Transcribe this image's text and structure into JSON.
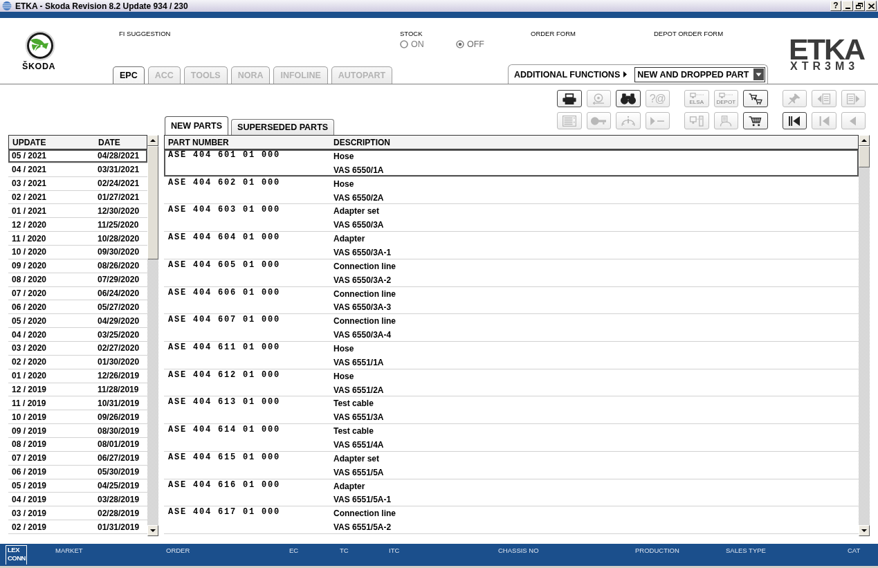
{
  "window": {
    "title": "ETKA - Skoda Revision 8.2 Update 934 / 230",
    "help_button": "?"
  },
  "header": {
    "brand": "ŠKODA",
    "fi_suggestion": "FI SUGGESTION",
    "stock": {
      "label": "STOCK",
      "options": [
        {
          "label": "ON",
          "selected": false
        },
        {
          "label": "OFF",
          "selected": true
        }
      ]
    },
    "order_form": "ORDER FORM",
    "depot_order_form": "DEPOT ORDER FORM",
    "logo": {
      "title": "ETKA",
      "subtitle": "XTR3M3"
    },
    "module_tabs": [
      {
        "label": "EPC",
        "selected": true,
        "disabled": false
      },
      {
        "label": "ACC",
        "selected": false,
        "disabled": true
      },
      {
        "label": "TOOLS",
        "selected": false,
        "disabled": true
      },
      {
        "label": "NORA",
        "selected": false,
        "disabled": true
      },
      {
        "label": "INFOLINE",
        "selected": false,
        "disabled": true
      },
      {
        "label": "AUTOPART",
        "selected": false,
        "disabled": true
      }
    ],
    "additional_functions": {
      "label": "ADDITIONAL FUNCTIONS",
      "value": "NEW AND DROPPED PART"
    }
  },
  "toolbar": {
    "rows": [
      {
        "groups": [
          {
            "buttons": [
              {
                "kind": "printer",
                "disabled": false
              },
              {
                "kind": "disc",
                "disabled": true
              },
              {
                "kind": "binoculars",
                "disabled": false
              },
              {
                "kind": "glyph",
                "label": "?@",
                "disabled": true
              }
            ]
          },
          {
            "buttons": [
              {
                "kind": "monitor",
                "label": "ELSA",
                "disabled": true
              },
              {
                "kind": "monitor",
                "label": "DEPOT",
                "disabled": true
              },
              {
                "kind": "carts",
                "disabled": false
              }
            ]
          },
          {
            "buttons": [
              {
                "kind": "pin",
                "disabled": true
              },
              {
                "kind": "pageback",
                "disabled": true
              },
              {
                "kind": "pagefwd",
                "disabled": true
              }
            ]
          }
        ]
      },
      {
        "groups": [
          {
            "buttons": [
              {
                "kind": "list",
                "disabled": true
              },
              {
                "kind": "key",
                "disabled": true
              },
              {
                "kind": "carinfo",
                "disabled": true
              },
              {
                "kind": "play",
                "disabled": true
              }
            ]
          },
          {
            "buttons": [
              {
                "kind": "terminal",
                "disabled": true
              },
              {
                "kind": "cardoc",
                "disabled": true
              },
              {
                "kind": "cart",
                "disabled": false
              }
            ]
          },
          {
            "buttons": [
              {
                "kind": "first",
                "disabled": false
              },
              {
                "kind": "start",
                "disabled": true
              },
              {
                "kind": "back",
                "disabled": true
              }
            ]
          }
        ]
      }
    ]
  },
  "updates": {
    "columns": [
      "UPDATE",
      "DATE"
    ],
    "rows": [
      {
        "update": "05 / 2021",
        "date": "04/28/2021",
        "selected": true
      },
      {
        "update": "04 / 2021",
        "date": "03/31/2021",
        "selected": false
      },
      {
        "update": "03 / 2021",
        "date": "02/24/2021",
        "selected": false
      },
      {
        "update": "02 / 2021",
        "date": "01/27/2021",
        "selected": false
      },
      {
        "update": "01 / 2021",
        "date": "12/30/2020",
        "selected": false
      },
      {
        "update": "12 / 2020",
        "date": "11/25/2020",
        "selected": false
      },
      {
        "update": "11 / 2020",
        "date": "10/28/2020",
        "selected": false
      },
      {
        "update": "10 / 2020",
        "date": "09/30/2020",
        "selected": false
      },
      {
        "update": "09 / 2020",
        "date": "08/26/2020",
        "selected": false
      },
      {
        "update": "08 / 2020",
        "date": "07/29/2020",
        "selected": false
      },
      {
        "update": "07 / 2020",
        "date": "06/24/2020",
        "selected": false
      },
      {
        "update": "06 / 2020",
        "date": "05/27/2020",
        "selected": false
      },
      {
        "update": "05 / 2020",
        "date": "04/29/2020",
        "selected": false
      },
      {
        "update": "04 / 2020",
        "date": "03/25/2020",
        "selected": false
      },
      {
        "update": "03 / 2020",
        "date": "02/27/2020",
        "selected": false
      },
      {
        "update": "02 / 2020",
        "date": "01/30/2020",
        "selected": false
      },
      {
        "update": "01 / 2020",
        "date": "12/26/2019",
        "selected": false
      },
      {
        "update": "12 / 2019",
        "date": "11/28/2019",
        "selected": false
      },
      {
        "update": "11 / 2019",
        "date": "10/31/2019",
        "selected": false
      },
      {
        "update": "10 / 2019",
        "date": "09/26/2019",
        "selected": false
      },
      {
        "update": "09 / 2019",
        "date": "08/30/2019",
        "selected": false
      },
      {
        "update": "08 / 2019",
        "date": "08/01/2019",
        "selected": false
      },
      {
        "update": "07 / 2019",
        "date": "06/27/2019",
        "selected": false
      },
      {
        "update": "06 / 2019",
        "date": "05/30/2019",
        "selected": false
      },
      {
        "update": "05 / 2019",
        "date": "04/25/2019",
        "selected": false
      },
      {
        "update": "04 / 2019",
        "date": "03/28/2019",
        "selected": false
      },
      {
        "update": "03 / 2019",
        "date": "02/28/2019",
        "selected": false
      },
      {
        "update": "02 / 2019",
        "date": "01/31/2019",
        "selected": false
      }
    ]
  },
  "parts": {
    "tabs": [
      {
        "label": "NEW PARTS",
        "selected": true
      },
      {
        "label": "SUPERSEDED PARTS",
        "selected": false
      }
    ],
    "columns": [
      "PART NUMBER",
      "DESCRIPTION"
    ],
    "rows": [
      {
        "part_number": "ASE 404 601 01 000",
        "description": "Hose",
        "code": "VAS 6550/1A",
        "selected": true
      },
      {
        "part_number": "ASE 404 602 01 000",
        "description": "Hose",
        "code": "VAS 6550/2A",
        "selected": false
      },
      {
        "part_number": "ASE 404 603 01 000",
        "description": "Adapter set",
        "code": "VAS 6550/3A",
        "selected": false
      },
      {
        "part_number": "ASE 404 604 01 000",
        "description": "Adapter",
        "code": "VAS 6550/3A-1",
        "selected": false
      },
      {
        "part_number": "ASE 404 605 01 000",
        "description": "Connection line",
        "code": "VAS 6550/3A-2",
        "selected": false
      },
      {
        "part_number": "ASE 404 606 01 000",
        "description": "Connection line",
        "code": "VAS 6550/3A-3",
        "selected": false
      },
      {
        "part_number": "ASE 404 607 01 000",
        "description": "Connection line",
        "code": "VAS 6550/3A-4",
        "selected": false
      },
      {
        "part_number": "ASE 404 611 01 000",
        "description": "Hose",
        "code": "VAS 6551/1A",
        "selected": false
      },
      {
        "part_number": "ASE 404 612 01 000",
        "description": "Hose",
        "code": "VAS 6551/2A",
        "selected": false
      },
      {
        "part_number": "ASE 404 613 01 000",
        "description": "Test cable",
        "code": "VAS 6551/3A",
        "selected": false
      },
      {
        "part_number": "ASE 404 614 01 000",
        "description": "Test cable",
        "code": "VAS 6551/4A",
        "selected": false
      },
      {
        "part_number": "ASE 404 615 01 000",
        "description": "Adapter set",
        "code": "VAS 6551/5A",
        "selected": false
      },
      {
        "part_number": "ASE 404 616 01 000",
        "description": "Adapter",
        "code": "VAS 6551/5A-1",
        "selected": false
      },
      {
        "part_number": "ASE 404 617 01 000",
        "description": "Connection line",
        "code": "VAS 6551/5A-2",
        "selected": false
      }
    ]
  },
  "status_bar": {
    "logo": [
      "LEX",
      "CONN"
    ],
    "fields": [
      "MARKET",
      "ORDER",
      "EC",
      "TC",
      "ITC",
      "CHASSIS NO",
      "PRODUCTION",
      "SALES TYPE",
      "CAT"
    ]
  }
}
